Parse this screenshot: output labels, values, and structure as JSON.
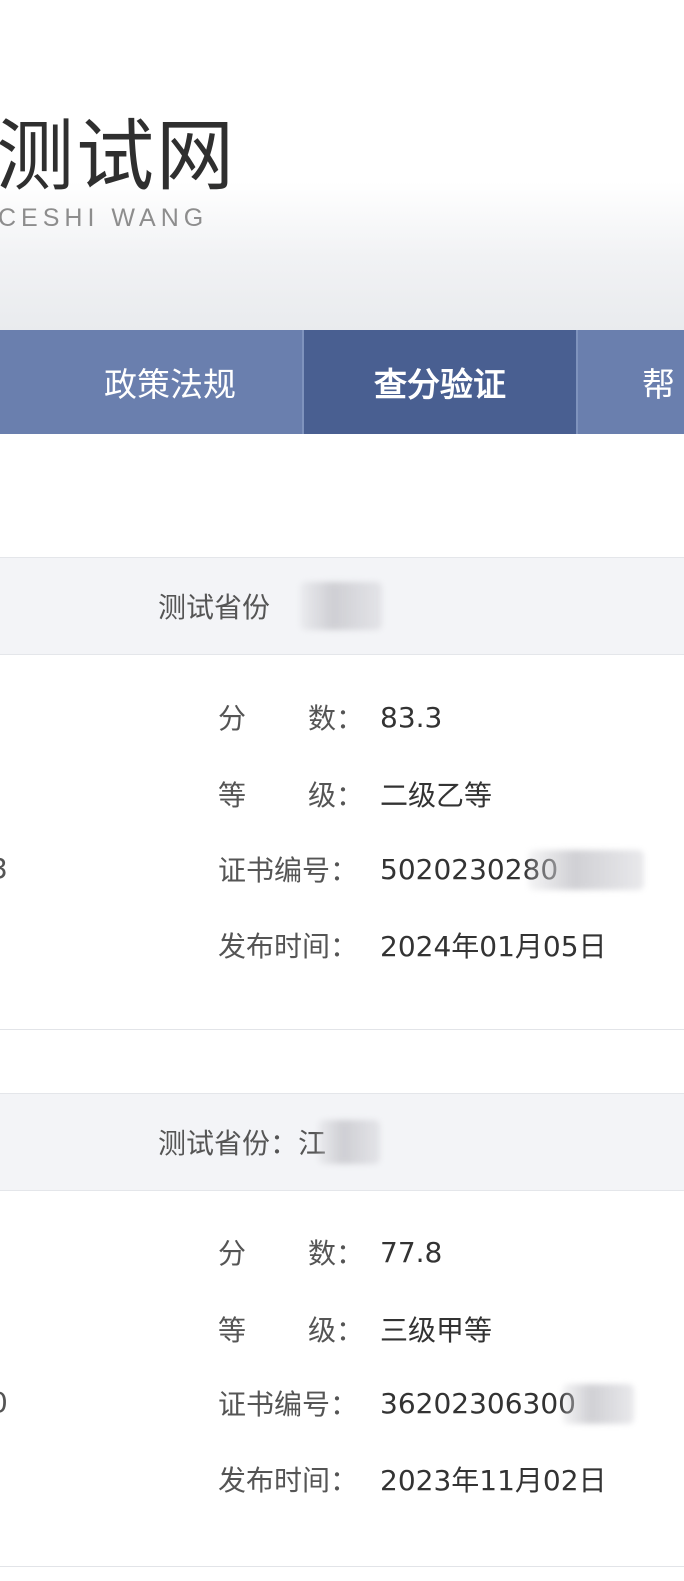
{
  "header": {
    "logo_cn": "测试网",
    "logo_en": "CESHI WANG"
  },
  "nav": {
    "items": [
      {
        "label": "政策法规",
        "active": false
      },
      {
        "label": "查分验证",
        "active": true
      },
      {
        "label": "帮"
      }
    ]
  },
  "results": [
    {
      "province_label": "测试省份",
      "province_value": "",
      "score_key_1": "分",
      "score_key_2": "数：",
      "score": "83.3",
      "level_key_1": "等",
      "level_key_2": "级：",
      "level": "二级乙等",
      "cert_key": "证书编号：",
      "cert_no": "5020230280",
      "date_key": "发布时间：",
      "date": "2024年01月05日",
      "left_edge": "3"
    },
    {
      "province_label": "测试省份：",
      "province_value": "江",
      "score_key_1": "分",
      "score_key_2": "数：",
      "score": "77.8",
      "level_key_1": "等",
      "level_key_2": "级：",
      "level": "三级甲等",
      "cert_key": "证书编号：",
      "cert_no": "36202306300",
      "date_key": "发布时间：",
      "date": "2023年11月02日",
      "left_edge": "0"
    }
  ],
  "colors": {
    "nav_bg": "#6a7fae",
    "nav_active_bg": "#495f91",
    "card_head_bg": "#f3f4f7"
  }
}
